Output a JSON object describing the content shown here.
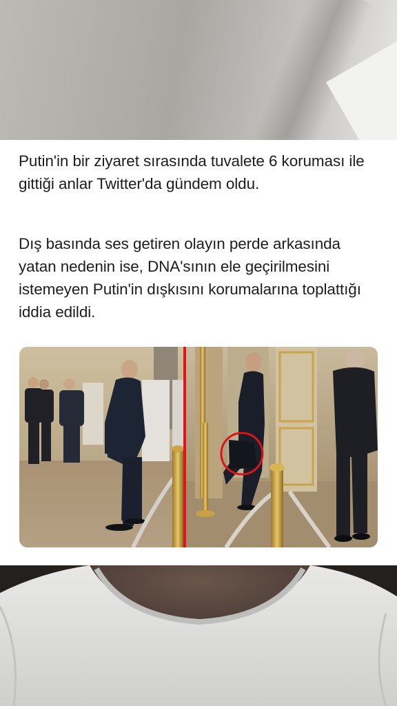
{
  "post": {
    "paragraph_1": "Putin'in bir ziyaret sırasında tuvalete 6 koruması ile gittiği anlar Twitter'da gündem oldu.",
    "paragraph_2": "Dış basında ses getiren olayın perde arkasında yatan nedenin ise, DNA'sının ele geçirilmesini istemeyen Putin'in dışkısını korumalarına toplattığı iddia edildi."
  },
  "colors": {
    "card_background": "#ffffff",
    "text": "#1d1d1d",
    "divider_line": "#e0141b",
    "highlight_circle": "#d8141c"
  }
}
